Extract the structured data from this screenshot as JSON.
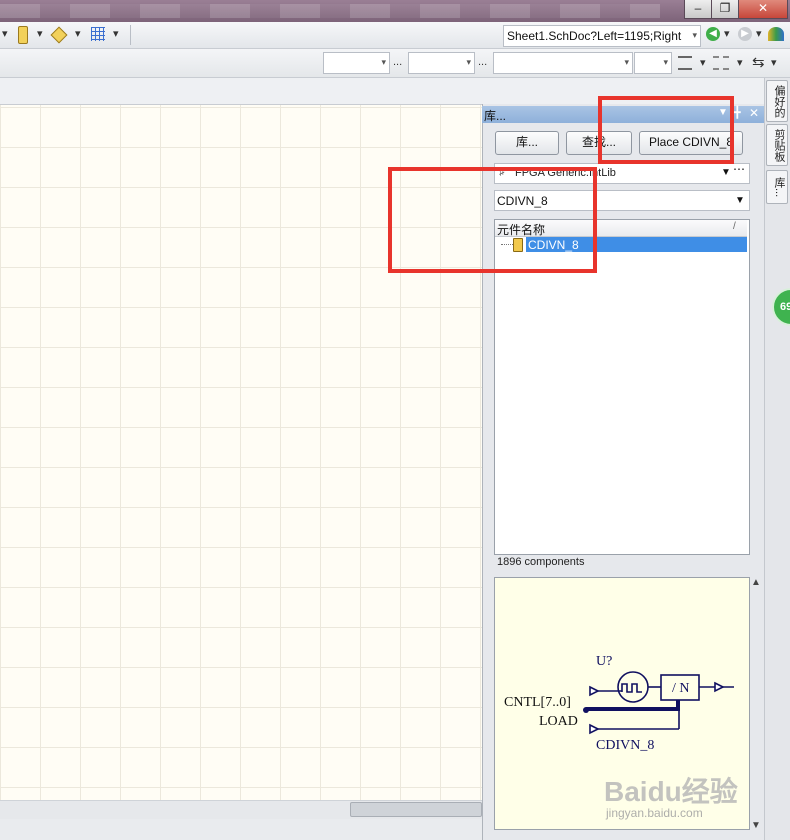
{
  "toolbar": {
    "address": "Sheet1.SchDoc?Left=1195;Right"
  },
  "panel": {
    "title": "库...",
    "buttons": {
      "libraries": "库...",
      "search": "查找...",
      "place": "Place CDIVN_8"
    },
    "library_name": "FPGA Generic.IntLib",
    "filter_value": "CDIVN_8",
    "column_header": "元件名称",
    "column_sort": "/",
    "items": [
      {
        "name": "CDIVN_8",
        "selected": true
      }
    ],
    "component_count": "1896 components"
  },
  "preview": {
    "designator": "U?",
    "pin_cntl": "CNTL[7..0]",
    "pin_load": "LOAD",
    "block_label": "/ N",
    "component_name": "CDIVN_8"
  },
  "side_tabs": [
    "偏好的",
    "剪贴板",
    "库..."
  ],
  "badge": "69",
  "watermark": {
    "main": "Baidu经验",
    "sub": "jingyan.baidu.com"
  },
  "colors": {
    "highlight": "#e8342c",
    "selection": "#3f8ee6",
    "panel_header": "#8eb0da"
  }
}
